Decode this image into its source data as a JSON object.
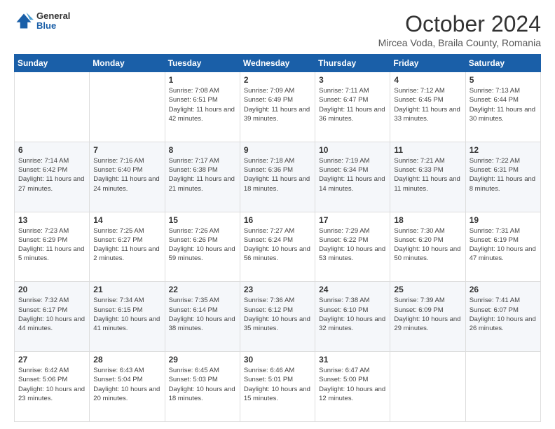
{
  "header": {
    "logo_general": "General",
    "logo_blue": "Blue",
    "month": "October 2024",
    "location": "Mircea Voda, Braila County, Romania"
  },
  "weekdays": [
    "Sunday",
    "Monday",
    "Tuesday",
    "Wednesday",
    "Thursday",
    "Friday",
    "Saturday"
  ],
  "weeks": [
    [
      {
        "day": "",
        "info": ""
      },
      {
        "day": "",
        "info": ""
      },
      {
        "day": "1",
        "info": "Sunrise: 7:08 AM\nSunset: 6:51 PM\nDaylight: 11 hours and 42 minutes."
      },
      {
        "day": "2",
        "info": "Sunrise: 7:09 AM\nSunset: 6:49 PM\nDaylight: 11 hours and 39 minutes."
      },
      {
        "day": "3",
        "info": "Sunrise: 7:11 AM\nSunset: 6:47 PM\nDaylight: 11 hours and 36 minutes."
      },
      {
        "day": "4",
        "info": "Sunrise: 7:12 AM\nSunset: 6:45 PM\nDaylight: 11 hours and 33 minutes."
      },
      {
        "day": "5",
        "info": "Sunrise: 7:13 AM\nSunset: 6:44 PM\nDaylight: 11 hours and 30 minutes."
      }
    ],
    [
      {
        "day": "6",
        "info": "Sunrise: 7:14 AM\nSunset: 6:42 PM\nDaylight: 11 hours and 27 minutes."
      },
      {
        "day": "7",
        "info": "Sunrise: 7:16 AM\nSunset: 6:40 PM\nDaylight: 11 hours and 24 minutes."
      },
      {
        "day": "8",
        "info": "Sunrise: 7:17 AM\nSunset: 6:38 PM\nDaylight: 11 hours and 21 minutes."
      },
      {
        "day": "9",
        "info": "Sunrise: 7:18 AM\nSunset: 6:36 PM\nDaylight: 11 hours and 18 minutes."
      },
      {
        "day": "10",
        "info": "Sunrise: 7:19 AM\nSunset: 6:34 PM\nDaylight: 11 hours and 14 minutes."
      },
      {
        "day": "11",
        "info": "Sunrise: 7:21 AM\nSunset: 6:33 PM\nDaylight: 11 hours and 11 minutes."
      },
      {
        "day": "12",
        "info": "Sunrise: 7:22 AM\nSunset: 6:31 PM\nDaylight: 11 hours and 8 minutes."
      }
    ],
    [
      {
        "day": "13",
        "info": "Sunrise: 7:23 AM\nSunset: 6:29 PM\nDaylight: 11 hours and 5 minutes."
      },
      {
        "day": "14",
        "info": "Sunrise: 7:25 AM\nSunset: 6:27 PM\nDaylight: 11 hours and 2 minutes."
      },
      {
        "day": "15",
        "info": "Sunrise: 7:26 AM\nSunset: 6:26 PM\nDaylight: 10 hours and 59 minutes."
      },
      {
        "day": "16",
        "info": "Sunrise: 7:27 AM\nSunset: 6:24 PM\nDaylight: 10 hours and 56 minutes."
      },
      {
        "day": "17",
        "info": "Sunrise: 7:29 AM\nSunset: 6:22 PM\nDaylight: 10 hours and 53 minutes."
      },
      {
        "day": "18",
        "info": "Sunrise: 7:30 AM\nSunset: 6:20 PM\nDaylight: 10 hours and 50 minutes."
      },
      {
        "day": "19",
        "info": "Sunrise: 7:31 AM\nSunset: 6:19 PM\nDaylight: 10 hours and 47 minutes."
      }
    ],
    [
      {
        "day": "20",
        "info": "Sunrise: 7:32 AM\nSunset: 6:17 PM\nDaylight: 10 hours and 44 minutes."
      },
      {
        "day": "21",
        "info": "Sunrise: 7:34 AM\nSunset: 6:15 PM\nDaylight: 10 hours and 41 minutes."
      },
      {
        "day": "22",
        "info": "Sunrise: 7:35 AM\nSunset: 6:14 PM\nDaylight: 10 hours and 38 minutes."
      },
      {
        "day": "23",
        "info": "Sunrise: 7:36 AM\nSunset: 6:12 PM\nDaylight: 10 hours and 35 minutes."
      },
      {
        "day": "24",
        "info": "Sunrise: 7:38 AM\nSunset: 6:10 PM\nDaylight: 10 hours and 32 minutes."
      },
      {
        "day": "25",
        "info": "Sunrise: 7:39 AM\nSunset: 6:09 PM\nDaylight: 10 hours and 29 minutes."
      },
      {
        "day": "26",
        "info": "Sunrise: 7:41 AM\nSunset: 6:07 PM\nDaylight: 10 hours and 26 minutes."
      }
    ],
    [
      {
        "day": "27",
        "info": "Sunrise: 6:42 AM\nSunset: 5:06 PM\nDaylight: 10 hours and 23 minutes."
      },
      {
        "day": "28",
        "info": "Sunrise: 6:43 AM\nSunset: 5:04 PM\nDaylight: 10 hours and 20 minutes."
      },
      {
        "day": "29",
        "info": "Sunrise: 6:45 AM\nSunset: 5:03 PM\nDaylight: 10 hours and 18 minutes."
      },
      {
        "day": "30",
        "info": "Sunrise: 6:46 AM\nSunset: 5:01 PM\nDaylight: 10 hours and 15 minutes."
      },
      {
        "day": "31",
        "info": "Sunrise: 6:47 AM\nSunset: 5:00 PM\nDaylight: 10 hours and 12 minutes."
      },
      {
        "day": "",
        "info": ""
      },
      {
        "day": "",
        "info": ""
      }
    ]
  ]
}
